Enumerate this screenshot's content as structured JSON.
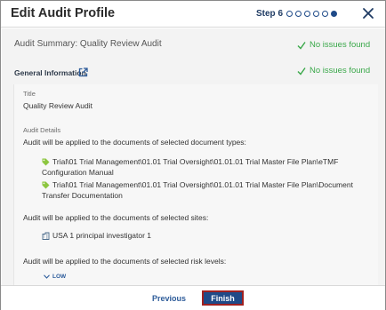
{
  "header": {
    "title": "Edit Audit Profile",
    "step_label": "Step 6",
    "steps_total": 6,
    "current_step": 6
  },
  "summary": {
    "title": "Audit Summary: Quality Review Audit",
    "status": "No issues found"
  },
  "general_info": {
    "label": "General Information",
    "status": "No issues found"
  },
  "details": {
    "title_label": "Title",
    "title_value": "Quality Review Audit",
    "audit_details_label": "Audit Details",
    "doc_types_intro": "Audit will be applied to the documents of selected document types:",
    "doc_types": [
      {
        "line1": "Trial\\01 Trial Management\\01.01 Trial Oversight\\01.01.01 Trial Master File Plan\\eTMF",
        "line2": "Configuration Manual"
      },
      {
        "line1": "Trial\\01 Trial Management\\01.01 Trial Oversight\\01.01.01 Trial Master File Plan\\Document",
        "line2": "Transfer Documentation"
      }
    ],
    "sites_intro": "Audit will be applied to the documents of selected sites:",
    "site": "USA 1 principal investigator 1",
    "risk_intro": "Audit will be applied to the documents of selected risk levels:",
    "risk_level": "LOW"
  },
  "footer": {
    "previous_label": "Previous",
    "finish_label": "Finish"
  },
  "colors": {
    "primary": "#1f4a88",
    "success": "#3aa84a",
    "tag": "#8cc63f",
    "highlight_border": "#a02020"
  }
}
